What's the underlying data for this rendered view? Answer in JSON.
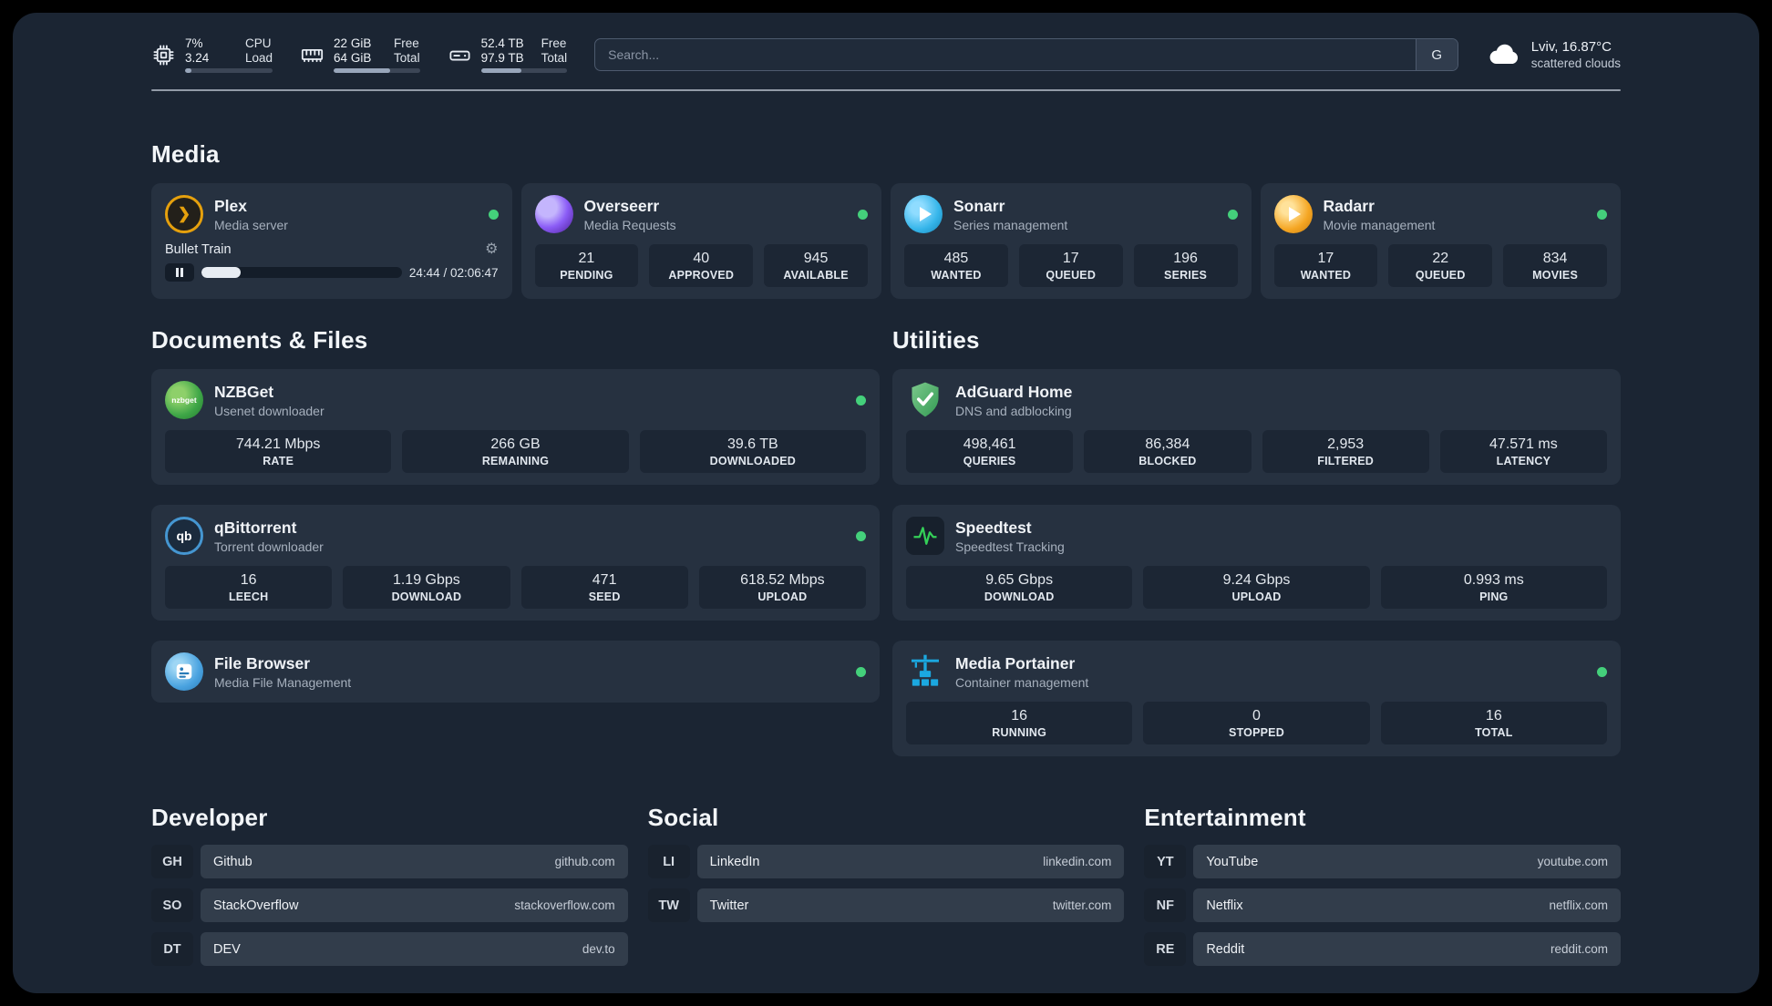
{
  "colors": {
    "background": "#1b2533",
    "card": "#263140",
    "stat_tile": "#1c2634",
    "status_online": "#44d07b",
    "accent_amber": "#e5a00d",
    "accent_blue": "#35b5ea"
  },
  "icons": {
    "gear": "⚙",
    "plex_chevron": "❯",
    "nzbget_label": "nzbget",
    "qbittorrent_label": "qb"
  },
  "topbar": {
    "cpu": {
      "value1": "7%",
      "label1": "CPU",
      "value2": "3.24",
      "label2": "Load",
      "bar_pct": 7
    },
    "memory": {
      "value1": "22 GiB",
      "label1": "Free",
      "value2": "64 GiB",
      "label2": "Total",
      "bar_pct": 66
    },
    "disk": {
      "value1": "52.4 TB",
      "label1": "Free",
      "value2": "97.9 TB",
      "label2": "Total",
      "bar_pct": 47
    },
    "search": {
      "placeholder": "Search...",
      "button": "G"
    },
    "weather": {
      "location": "Lviv, 16.87°C",
      "condition": "scattered clouds"
    }
  },
  "sections": {
    "media": {
      "title": "Media",
      "plex": {
        "name": "Plex",
        "desc": "Media server",
        "status": "online",
        "player": {
          "title": "Bullet Train",
          "time": "24:44 / 02:06:47",
          "progress_pct": 19.5
        }
      },
      "overseerr": {
        "name": "Overseerr",
        "desc": "Media Requests",
        "status": "online",
        "stats": [
          {
            "value": "21",
            "label": "PENDING"
          },
          {
            "value": "40",
            "label": "APPROVED"
          },
          {
            "value": "945",
            "label": "AVAILABLE"
          }
        ]
      },
      "sonarr": {
        "name": "Sonarr",
        "desc": "Series management",
        "status": "online",
        "stats": [
          {
            "value": "485",
            "label": "WANTED"
          },
          {
            "value": "17",
            "label": "QUEUED"
          },
          {
            "value": "196",
            "label": "SERIES"
          }
        ]
      },
      "radarr": {
        "name": "Radarr",
        "desc": "Movie management",
        "status": "online",
        "stats": [
          {
            "value": "17",
            "label": "WANTED"
          },
          {
            "value": "22",
            "label": "QUEUED"
          },
          {
            "value": "834",
            "label": "MOVIES"
          }
        ]
      }
    },
    "documents": {
      "title": "Documents & Files",
      "nzbget": {
        "name": "NZBGet",
        "desc": "Usenet downloader",
        "status": "online",
        "stats": [
          {
            "value": "744.21 Mbps",
            "label": "RATE"
          },
          {
            "value": "266 GB",
            "label": "REMAINING"
          },
          {
            "value": "39.6 TB",
            "label": "DOWNLOADED"
          }
        ]
      },
      "qbittorrent": {
        "name": "qBittorrent",
        "desc": "Torrent downloader",
        "status": "online",
        "stats": [
          {
            "value": "16",
            "label": "LEECH"
          },
          {
            "value": "1.19 Gbps",
            "label": "DOWNLOAD"
          },
          {
            "value": "471",
            "label": "SEED"
          },
          {
            "value": "618.52 Mbps",
            "label": "UPLOAD"
          }
        ]
      },
      "filebrowser": {
        "name": "File Browser",
        "desc": "Media File Management",
        "status": "online"
      }
    },
    "utilities": {
      "title": "Utilities",
      "adguard": {
        "name": "AdGuard Home",
        "desc": "DNS and adblocking",
        "stats": [
          {
            "value": "498,461",
            "label": "QUERIES"
          },
          {
            "value": "86,384",
            "label": "BLOCKED"
          },
          {
            "value": "2,953",
            "label": "FILTERED"
          },
          {
            "value": "47.571 ms",
            "label": "LATENCY"
          }
        ]
      },
      "speedtest": {
        "name": "Speedtest",
        "desc": "Speedtest Tracking",
        "stats": [
          {
            "value": "9.65 Gbps",
            "label": "DOWNLOAD"
          },
          {
            "value": "9.24 Gbps",
            "label": "UPLOAD"
          },
          {
            "value": "0.993 ms",
            "label": "PING"
          }
        ]
      },
      "portainer": {
        "name": "Media Portainer",
        "desc": "Container management",
        "status": "online",
        "stats": [
          {
            "value": "16",
            "label": "RUNNING"
          },
          {
            "value": "0",
            "label": "STOPPED"
          },
          {
            "value": "16",
            "label": "TOTAL"
          }
        ]
      }
    },
    "bookmarks": [
      {
        "title": "Developer",
        "items": [
          {
            "abbr": "GH",
            "name": "Github",
            "url": "github.com"
          },
          {
            "abbr": "SO",
            "name": "StackOverflow",
            "url": "stackoverflow.com"
          },
          {
            "abbr": "DT",
            "name": "DEV",
            "url": "dev.to"
          }
        ]
      },
      {
        "title": "Social",
        "items": [
          {
            "abbr": "LI",
            "name": "LinkedIn",
            "url": "linkedin.com"
          },
          {
            "abbr": "TW",
            "name": "Twitter",
            "url": "twitter.com"
          }
        ]
      },
      {
        "title": "Entertainment",
        "items": [
          {
            "abbr": "YT",
            "name": "YouTube",
            "url": "youtube.com"
          },
          {
            "abbr": "NF",
            "name": "Netflix",
            "url": "netflix.com"
          },
          {
            "abbr": "RE",
            "name": "Reddit",
            "url": "reddit.com"
          }
        ]
      }
    ]
  }
}
